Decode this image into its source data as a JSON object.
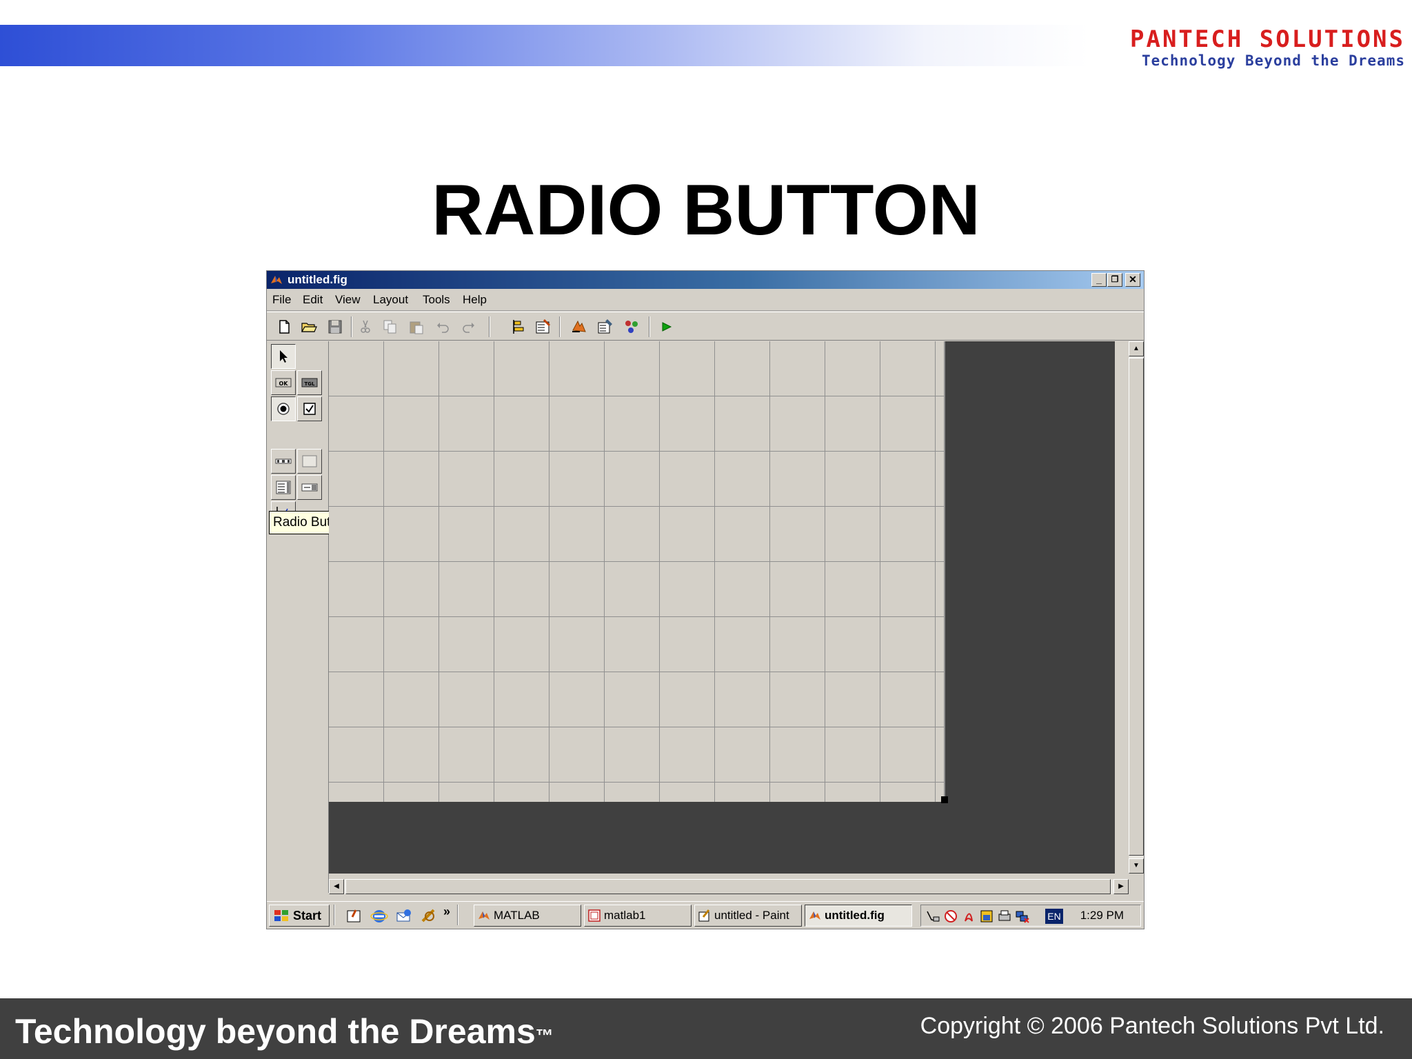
{
  "logo": {
    "name": "PANTECH SOLUTIONS",
    "tagline": "Technology Beyond the Dreams"
  },
  "slide": {
    "title": "RADIO BUTTON"
  },
  "window": {
    "title": "untitled.fig",
    "controls": {
      "minimize": "_",
      "restore": "❐",
      "close": "✕"
    }
  },
  "menubar": {
    "items": [
      "File",
      "Edit",
      "View",
      "Layout",
      "Tools",
      "Help"
    ]
  },
  "toolbar": {
    "icons": [
      "new-file-icon",
      "open-folder-icon",
      "save-icon",
      "cut-icon",
      "copy-icon",
      "paste-icon",
      "undo-icon",
      "redo-icon",
      "align-objects-icon",
      "menu-editor-icon",
      "property-inspector-icon",
      "object-browser-icon",
      "m-file-editor-icon",
      "run-icon"
    ]
  },
  "palette": {
    "tooltip": "Radio Button",
    "labels": {
      "ok": "OK",
      "tgl": "TGL"
    }
  },
  "taskbar": {
    "start_label": "Start",
    "overflow": "»",
    "tasks": [
      {
        "label": "MATLAB",
        "active": false
      },
      {
        "label": "matlab1",
        "active": false
      },
      {
        "label": "untitled - Paint",
        "active": false
      },
      {
        "label": "untitled.fig",
        "active": true
      }
    ],
    "language": "EN",
    "clock": "1:29 PM"
  },
  "footer": {
    "tagline": "Technology beyond the Dreams",
    "trademark": "™",
    "copyright": "Copyright © 2006 Pantech Solutions Pvt Ltd."
  },
  "colors": {
    "titlebar": "#0a246a",
    "window_face": "#d4d0c8",
    "footer": "#404040",
    "logo_red": "#d81e1e",
    "logo_blue": "#2b3f9e"
  }
}
